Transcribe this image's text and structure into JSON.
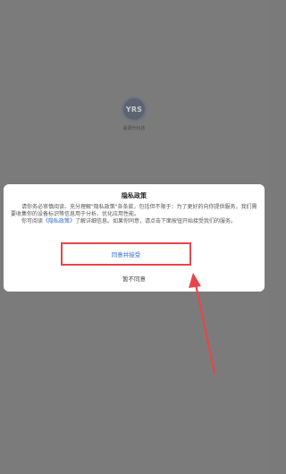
{
  "splash": {
    "logo_text": "YRS",
    "app_name": "易驿升科技"
  },
  "dialog": {
    "title": "隐私政策",
    "paragraph1": "请你务必审慎阅读、充分理解\"隐私政策\"各条款，包括但不限于：为了更好的向你提供服务，我们需要收集你的设备标识等信息用于分析、优化应用性能。",
    "paragraph2_prefix": "你可阅读",
    "policy_link": "《隐私政策》",
    "paragraph2_suffix": "了解详细信息。如果你同意，请点击下面按钮开始接受我们的服务。",
    "agree_label": "同意并接受",
    "disagree_label": "暂不同意"
  },
  "colors": {
    "backdrop": "#7b7b7b",
    "link": "#2e6ccf",
    "highlight": "#e6464b"
  }
}
